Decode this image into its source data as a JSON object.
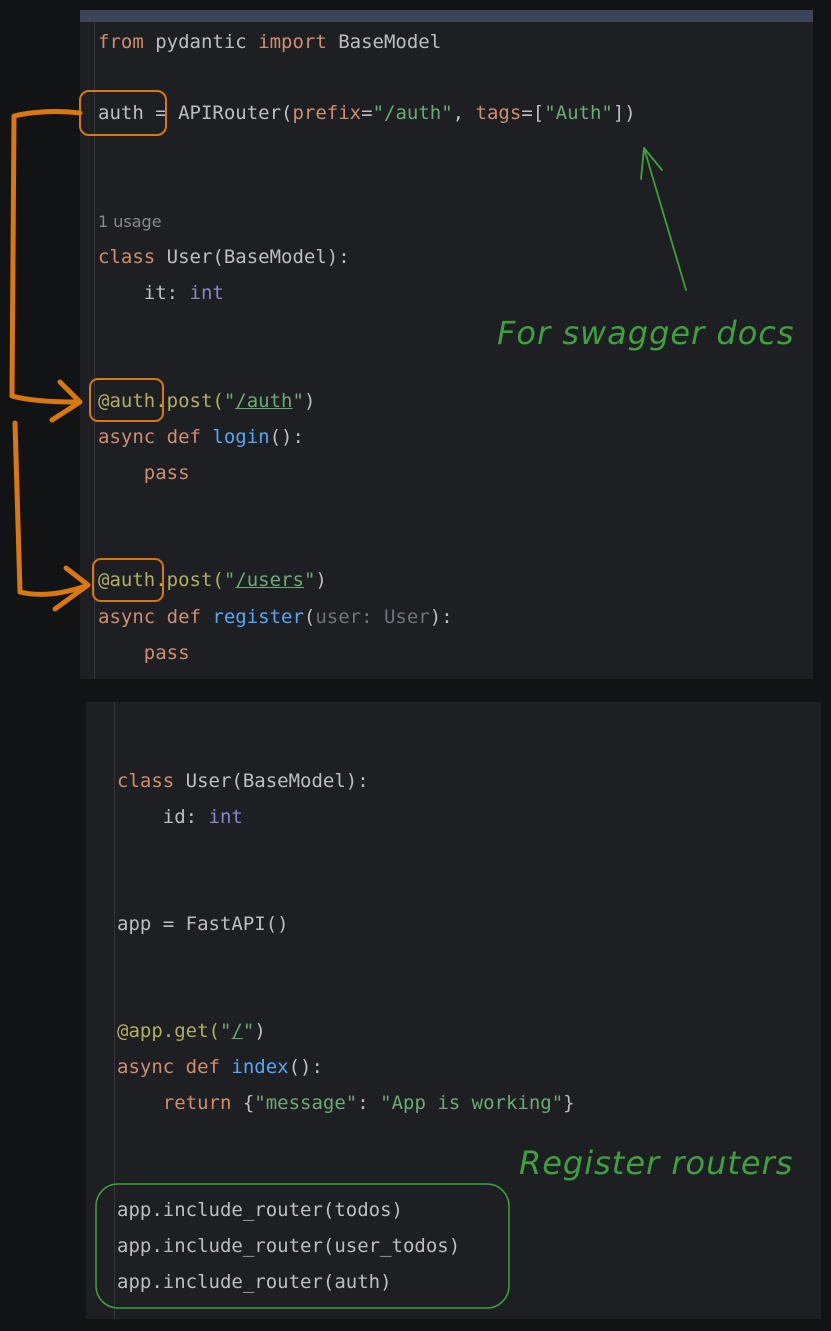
{
  "top_editor": {
    "usage_hint": "1 usage",
    "lines": {
      "l1": [
        "from",
        " pydantic ",
        "import",
        " BaseModel"
      ],
      "l2": [
        "auth",
        " = APIRouter(",
        "prefix",
        "=",
        "\"/auth\"",
        ", ",
        "tags",
        "=[",
        "\"Auth\"",
        "])"
      ],
      "l3": [
        "class",
        " User(BaseModel):"
      ],
      "l4": [
        "    it: ",
        "int"
      ],
      "l5": [
        "@auth",
        ".post(",
        "\"",
        "/auth",
        "\"",
        ")"
      ],
      "l6": [
        "async def ",
        "login",
        "():"
      ],
      "l7": [
        "    ",
        "pass"
      ],
      "l8": [
        "@auth",
        ".post(",
        "\"",
        "/users",
        "\"",
        ")"
      ],
      "l9": [
        "async def ",
        "register",
        "(",
        "user: User",
        "):"
      ],
      "l10": [
        "    ",
        "pass"
      ]
    }
  },
  "bottom_editor": {
    "lines": {
      "b1": [
        "class",
        " User(BaseModel):"
      ],
      "b2": [
        "    id: ",
        "int"
      ],
      "b3": [
        "app = FastAPI()"
      ],
      "b4": [
        "@app.get(",
        "\"",
        "/",
        "\"",
        ")"
      ],
      "b5": [
        "async def ",
        "index",
        "():"
      ],
      "b6": [
        "    ",
        "return",
        " {",
        "\"message\"",
        ": ",
        "\"App is working\"",
        "}"
      ],
      "b7": [
        "app.include_router(todos)"
      ],
      "b8": [
        "app.include_router(user_todos)"
      ],
      "b9": [
        "app.include_router(auth)"
      ]
    }
  },
  "annotations": {
    "swagger_note": "For swagger docs",
    "register_note": "Register routers"
  },
  "colors": {
    "orange_annotation": "#d9780f",
    "green_annotation": "#3fa03f"
  }
}
